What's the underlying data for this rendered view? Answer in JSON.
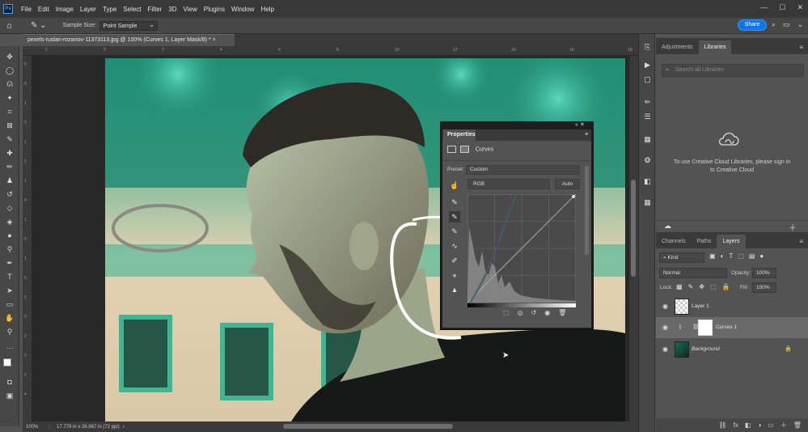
{
  "menubar": {
    "logo": "Ps",
    "items": [
      "File",
      "Edit",
      "Image",
      "Layer",
      "Type",
      "Select",
      "Filter",
      "3D",
      "View",
      "Plugins",
      "Window",
      "Help"
    ],
    "window_controls": [
      "—",
      "☐",
      "✕"
    ]
  },
  "options": {
    "sample_size_label": "Sample Size:",
    "sample_size_value": "Point Sample",
    "share_label": "Share"
  },
  "document": {
    "tab_title": "pexels-ruslan-rozanov-11373113.jpg @ 100% (Curves 1, Layer Mask/8) *",
    "tab_close": "×"
  },
  "rulers": {
    "top": [
      "2",
      "0",
      "2",
      "4",
      "6",
      "8",
      "10",
      "12",
      "14",
      "16",
      "18"
    ],
    "left": [
      "6",
      "8",
      "1",
      "0",
      "1",
      "2",
      "1",
      "4",
      "1",
      "6",
      "1",
      "8",
      "2",
      "0",
      "2",
      "2",
      "2",
      "4"
    ]
  },
  "status": {
    "zoom": "100%",
    "info": "17.778 in x 26.667 in (72 ppi)",
    "arrow": "›"
  },
  "panels": {
    "top_tabs": [
      "Adjustments",
      "Libraries"
    ],
    "library_search_placeholder": "Search all Libraries",
    "library_message": "To use Creative Cloud Libraries, please sign in to Creative Cloud",
    "bottom_tabs": [
      "Channels",
      "Paths",
      "Layers"
    ],
    "kind_label": "Kind",
    "blend_mode": "Normal",
    "opacity_label": "Opacity:",
    "opacity_value": "100%",
    "lock_label": "Lock:",
    "fill_label": "Fill:",
    "fill_value": "100%",
    "layers": [
      {
        "name": "Layer 1"
      },
      {
        "name": "Curves 1"
      },
      {
        "name": "Background"
      }
    ],
    "footer_icons": [
      "fx",
      "◧",
      "◑",
      "▭",
      "＋",
      "🗑"
    ]
  },
  "properties": {
    "tab": "Properties",
    "close": "«",
    "close_x": "✕",
    "menu": "≡",
    "type_label": "Curves",
    "preset_label": "Preset:",
    "preset_value": "Custom",
    "channel_value": "RGB",
    "auto_label": "Auto"
  },
  "colors": {
    "accent": "#1473e6",
    "panel_bg": "#535353",
    "dark_bg": "#383838",
    "teal_photo": "#2ea58c"
  }
}
